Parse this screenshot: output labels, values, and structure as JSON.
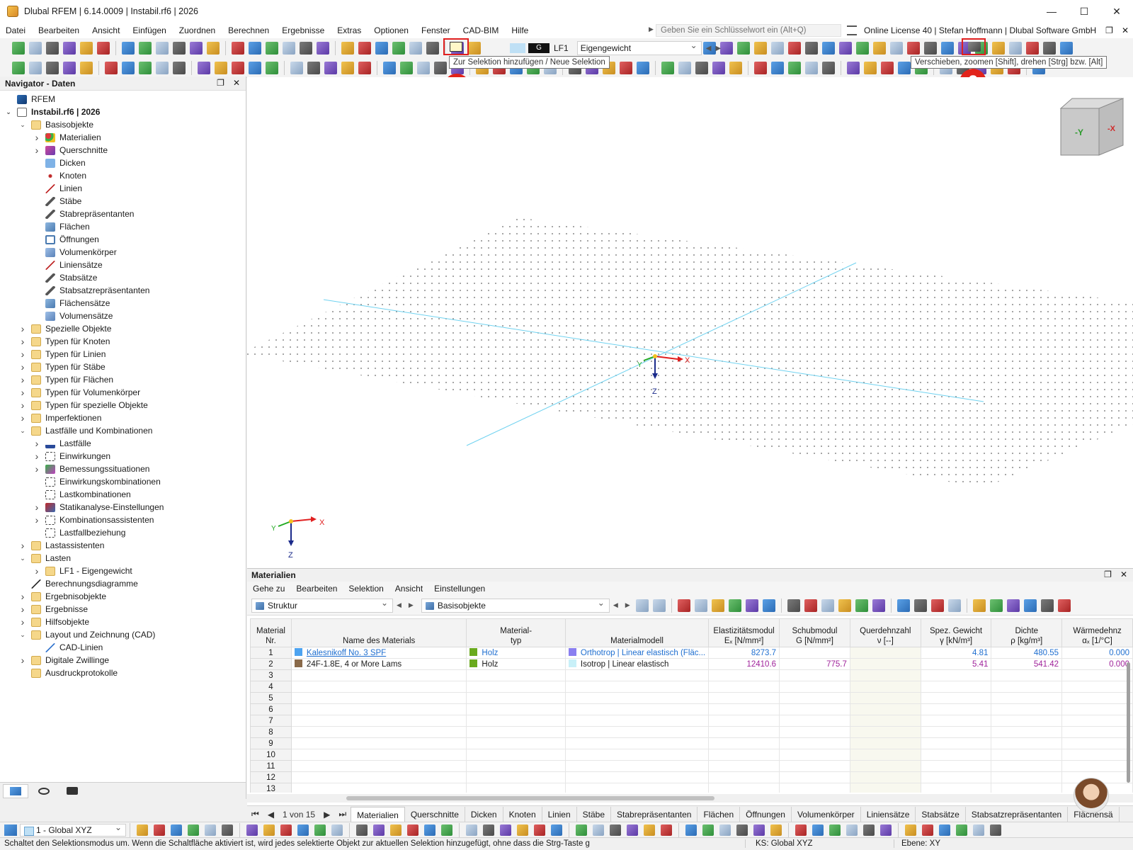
{
  "window": {
    "title": "Dlubal RFEM | 6.14.0009 | Instabil.rf6 | 2026",
    "minimize": "—",
    "maximize": "☐",
    "close": "✕"
  },
  "menu": [
    "Datei",
    "Bearbeiten",
    "Ansicht",
    "Einfügen",
    "Zuordnen",
    "Berechnen",
    "Ergebnisse",
    "Extras",
    "Optionen",
    "Fenster",
    "CAD-BIM",
    "Hilfe"
  ],
  "search": {
    "placeholder": "Geben Sie ein Schlüsselwort ein (Alt+Q)"
  },
  "license": "Online License 40 | Stefan Hoffmann | Dlubal Software GmbH",
  "mdi": {
    "restore": "❐",
    "close": "✕"
  },
  "loadcase": {
    "badge": "G",
    "name": "LF1",
    "description": "Eigengewicht"
  },
  "tooltips": {
    "selection": "Zur Selektion hinzufügen / Neue Selektion",
    "view": "Verschieben, zoomen [Shift], drehen [Strg] bzw. [Alt]"
  },
  "markers": {
    "one": "1",
    "two": "2"
  },
  "navigator": {
    "title": "Navigator - Daten",
    "items": [
      {
        "label": "RFEM",
        "level": 0,
        "chev": "",
        "icon": "rfem",
        "bold": false
      },
      {
        "label": "Instabil.rf6 | 2026",
        "level": 0,
        "chev": "v",
        "icon": "model",
        "bold": true
      },
      {
        "label": "Basisobjekte",
        "level": 1,
        "chev": "v",
        "icon": "folder",
        "bold": false
      },
      {
        "label": "Materialien",
        "level": 2,
        "chev": ">",
        "icon": "materials",
        "bold": false
      },
      {
        "label": "Querschnitte",
        "level": 2,
        "chev": ">",
        "icon": "sections",
        "bold": false
      },
      {
        "label": "Dicken",
        "level": 2,
        "chev": "",
        "icon": "thickness",
        "bold": false
      },
      {
        "label": "Knoten",
        "level": 2,
        "chev": "",
        "icon": "node",
        "bold": false
      },
      {
        "label": "Linien",
        "level": 2,
        "chev": "",
        "icon": "line",
        "bold": false
      },
      {
        "label": "Stäbe",
        "level": 2,
        "chev": "",
        "icon": "member",
        "bold": false
      },
      {
        "label": "Stabrepräsentanten",
        "level": 2,
        "chev": "",
        "icon": "member",
        "bold": false
      },
      {
        "label": "Flächen",
        "level": 2,
        "chev": "",
        "icon": "surface",
        "bold": false
      },
      {
        "label": "Öffnungen",
        "level": 2,
        "chev": "",
        "icon": "opening",
        "bold": false
      },
      {
        "label": "Volumenkörper",
        "level": 2,
        "chev": "",
        "icon": "solid",
        "bold": false
      },
      {
        "label": "Liniensätze",
        "level": 2,
        "chev": "",
        "icon": "line",
        "bold": false
      },
      {
        "label": "Stabsätze",
        "level": 2,
        "chev": "",
        "icon": "member",
        "bold": false
      },
      {
        "label": "Stabsatzrepräsentanten",
        "level": 2,
        "chev": "",
        "icon": "member",
        "bold": false
      },
      {
        "label": "Flächensätze",
        "level": 2,
        "chev": "",
        "icon": "surface",
        "bold": false
      },
      {
        "label": "Volumensätze",
        "level": 2,
        "chev": "",
        "icon": "solid",
        "bold": false
      },
      {
        "label": "Spezielle Objekte",
        "level": 1,
        "chev": ">",
        "icon": "folder",
        "bold": false
      },
      {
        "label": "Typen für Knoten",
        "level": 1,
        "chev": ">",
        "icon": "folder",
        "bold": false
      },
      {
        "label": "Typen für Linien",
        "level": 1,
        "chev": ">",
        "icon": "folder",
        "bold": false
      },
      {
        "label": "Typen für Stäbe",
        "level": 1,
        "chev": ">",
        "icon": "folder",
        "bold": false
      },
      {
        "label": "Typen für Flächen",
        "level": 1,
        "chev": ">",
        "icon": "folder",
        "bold": false
      },
      {
        "label": "Typen für Volumenkörper",
        "level": 1,
        "chev": ">",
        "icon": "folder",
        "bold": false
      },
      {
        "label": "Typen für spezielle Objekte",
        "level": 1,
        "chev": ">",
        "icon": "folder",
        "bold": false
      },
      {
        "label": "Imperfektionen",
        "level": 1,
        "chev": ">",
        "icon": "folder",
        "bold": false
      },
      {
        "label": "Lastfälle und Kombinationen",
        "level": 1,
        "chev": "v",
        "icon": "folder",
        "bold": false
      },
      {
        "label": "Lastfälle",
        "level": 2,
        "chev": ">",
        "icon": "loadcase",
        "bold": false
      },
      {
        "label": "Einwirkungen",
        "level": 2,
        "chev": ">",
        "icon": "action",
        "bold": false
      },
      {
        "label": "Bemessungssituationen",
        "level": 2,
        "chev": ">",
        "icon": "design",
        "bold": false
      },
      {
        "label": "Einwirkungskombinationen",
        "level": 2,
        "chev": "",
        "icon": "action",
        "bold": false
      },
      {
        "label": "Lastkombinationen",
        "level": 2,
        "chev": "",
        "icon": "action",
        "bold": false
      },
      {
        "label": "Statikanalyse-Einstellungen",
        "level": 2,
        "chev": ">",
        "icon": "analysis",
        "bold": false
      },
      {
        "label": "Kombinationsassistenten",
        "level": 2,
        "chev": ">",
        "icon": "action",
        "bold": false
      },
      {
        "label": "Lastfallbeziehung",
        "level": 2,
        "chev": "",
        "icon": "action",
        "bold": false
      },
      {
        "label": "Lastassistenten",
        "level": 1,
        "chev": ">",
        "icon": "folder",
        "bold": false
      },
      {
        "label": "Lasten",
        "level": 1,
        "chev": "v",
        "icon": "folder",
        "bold": false
      },
      {
        "label": "LF1 - Eigengewicht",
        "level": 2,
        "chev": ">",
        "icon": "folder",
        "bold": false
      },
      {
        "label": "Berechnungsdiagramme",
        "level": 1,
        "chev": "",
        "icon": "diagram",
        "bold": false
      },
      {
        "label": "Ergebnisobjekte",
        "level": 1,
        "chev": ">",
        "icon": "folder",
        "bold": false
      },
      {
        "label": "Ergebnisse",
        "level": 1,
        "chev": ">",
        "icon": "folder",
        "bold": false
      },
      {
        "label": "Hilfsobjekte",
        "level": 1,
        "chev": ">",
        "icon": "folder",
        "bold": false
      },
      {
        "label": "Layout und Zeichnung (CAD)",
        "level": 1,
        "chev": "v",
        "icon": "folder",
        "bold": false
      },
      {
        "label": "CAD-Linien",
        "level": 2,
        "chev": "",
        "icon": "cadline",
        "bold": false
      },
      {
        "label": "Digitale Zwillinge",
        "level": 1,
        "chev": ">",
        "icon": "folder",
        "bold": false
      },
      {
        "label": "Ausdruckprotokolle",
        "level": 1,
        "chev": "",
        "icon": "folder",
        "bold": false
      }
    ]
  },
  "viewport": {
    "axes": {
      "x": "X",
      "y": "Y",
      "z": "Z"
    },
    "cube": {
      "front": "-Y",
      "right": "-X"
    }
  },
  "table": {
    "title": "Materialien",
    "menu": [
      "Gehe zu",
      "Bearbeiten",
      "Selektion",
      "Ansicht",
      "Einstellungen"
    ],
    "filter_left": "Struktur",
    "filter_right": "Basisobjekte",
    "headers": [
      "Material\nNr.",
      "Name des Materials",
      "Material-\ntyp",
      "Materialmodell",
      "Elastizitätsmodul\nEₓ [N/mm²]",
      "Schubmodul\nG [N/mm²]",
      "Querdehnzahl\nν [--]",
      "Spez. Gewicht\nγ [kN/m³]",
      "Dichte\nρ [kg/m³]",
      "Wärmedehnz\nαₓ [1/°C]"
    ],
    "rows": [
      {
        "nr": "1",
        "name": "Kalesnikoff No. 3 SPF",
        "name_color": "#4da3f0",
        "type": "Holz",
        "type_color": "#6aaa1e",
        "model": "Orthotrop | Linear elastisch (Fläc...",
        "model_color": "#8a7ff0",
        "e": "8273.7",
        "g": "",
        "nu": "",
        "gamma": "4.81",
        "rho": "480.55",
        "alpha": "0.000",
        "selected": true
      },
      {
        "nr": "2",
        "name": "24F-1.8E, 4 or More Lams",
        "name_color": "#8a6a4a",
        "type": "Holz",
        "type_color": "#6aaa1e",
        "model": "Isotrop | Linear elastisch",
        "model_color": "#c8f0f8",
        "e": "12410.6",
        "g": "775.7",
        "nu": "",
        "gamma": "5.41",
        "rho": "541.42",
        "alpha": "0.000",
        "selected": false
      },
      {
        "nr": "3"
      },
      {
        "nr": "4"
      },
      {
        "nr": "5"
      },
      {
        "nr": "6"
      },
      {
        "nr": "7"
      },
      {
        "nr": "8"
      },
      {
        "nr": "9"
      },
      {
        "nr": "10"
      },
      {
        "nr": "11"
      },
      {
        "nr": "12"
      },
      {
        "nr": "13"
      }
    ],
    "pager": "1 von 15",
    "tabs": [
      "Materialien",
      "Querschnitte",
      "Dicken",
      "Knoten",
      "Linien",
      "Stäbe",
      "Stabrepräsentanten",
      "Flächen",
      "Öffnungen",
      "Volumenkörper",
      "Liniensätze",
      "Stabsätze",
      "Stabsatzrepräsentanten",
      "Flächensä"
    ]
  },
  "bottom": {
    "cs": "1 - Global XYZ"
  },
  "status": {
    "message": "Schaltet den Selektionsmodus um. Wenn die Schaltfläche aktiviert ist, wird jedes selektierte Objekt zur aktuellen Selektion hinzugefügt, ohne dass die Strg-Taste g",
    "cs": "KS: Global XYZ",
    "plane": "Ebene: XY"
  }
}
